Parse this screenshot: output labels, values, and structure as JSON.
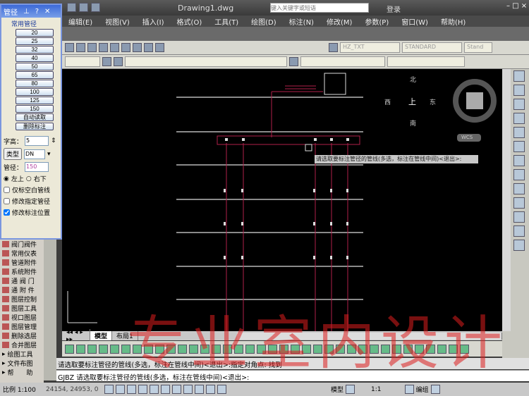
{
  "title": "Drawing1.dwg",
  "search_placeholder": "键入关键字或短语",
  "login": "登录",
  "menu": [
    "编辑(E)",
    "视图(V)",
    "插入(I)",
    "格式(O)",
    "工具(T)",
    "绘图(D)",
    "标注(N)",
    "修改(M)",
    "参数(P)",
    "窗口(W)",
    "帮助(H)"
  ],
  "toolbar": {
    "text_style": "HZ_TXT",
    "dim_style": "STANDARD",
    "table_style": "Stand"
  },
  "dialog": {
    "title": "管径",
    "section": "常用管径",
    "sizes": [
      "20",
      "25",
      "32",
      "40",
      "50",
      "65",
      "80",
      "100",
      "125",
      "150"
    ],
    "auto_read": "自动读取",
    "delete_label": "删除标注",
    "text_height_label": "字高：",
    "text_height": "5",
    "type_button": "类型",
    "type_value": "DN",
    "diameter_label": "管径：",
    "diameter_value": "150",
    "pos_left_top": "左上",
    "pos_right_bottom": "右下",
    "only_blank": "仅标空白管线",
    "modify_specified": "修改指定管径",
    "modify_position": "修改标注位置",
    "only_blank_checked": false,
    "modify_specified_checked": false,
    "modify_position_checked": true
  },
  "palette": [
    "阀门阀件",
    "常用仪表",
    "管道附件",
    "系统附件",
    "通 阀 门",
    "通 附 件",
    "图层控制",
    "图层工具",
    "视口图层",
    "图层管理",
    "删除选层",
    "合并图层",
    "绘图工具",
    "文件布图",
    "帮　　助"
  ],
  "compass": {
    "north": "北",
    "south": "南",
    "east": "东",
    "west": "西",
    "top": "上",
    "ucs": "WCS"
  },
  "tooltip": "请选取要标注管径的管线(多选，标注在管线中间)<退出>:",
  "layout_tabs": [
    "模型",
    "布局1"
  ],
  "command": {
    "history": "请选取要标注管径的管线(多选，标注在管线中间)<退出>:指定对角点: 找到",
    "prompt": "GJBZ 请选取要标注管径的管线(多选，标注在管线中间)<退出>:"
  },
  "status": {
    "scale": "比例 1:100",
    "coords": "24154, 24953, 0",
    "model": "模型",
    "anno_scale": "1:1",
    "workspace": "编组"
  },
  "watermark": "专业室内设计"
}
